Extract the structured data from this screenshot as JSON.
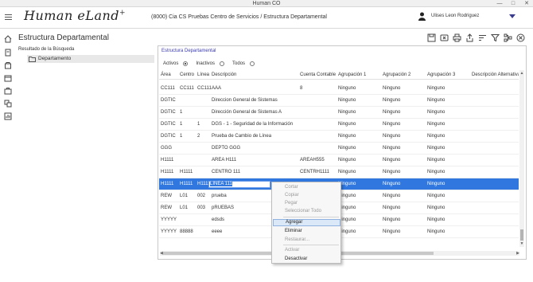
{
  "window": {
    "title": "Human CO",
    "controls": [
      "—",
      "□",
      "✕"
    ]
  },
  "header": {
    "logo": "Human eLand",
    "logo_mark": "+",
    "breadcrumb": "(8000) Cia  CS  Pruebas Centro de Servicios / Estructura Departamental",
    "user_name": "Ulises Leon Rodriguez"
  },
  "page": {
    "title": "Estructura Departamental"
  },
  "toolbar": {
    "icons": [
      "save-icon",
      "cancel-icon",
      "print-icon",
      "export-icon",
      "sort-icon",
      "filter-icon",
      "hierarchy-icon",
      "close-icon"
    ]
  },
  "tree": {
    "heading": "Resultado de la Búsqueda",
    "node_label": "Departamento"
  },
  "panel": {
    "title": "Estructura Departamental",
    "filters": {
      "active": "Activos",
      "inactive": "Inactivos",
      "all": "Todos",
      "selected": "active"
    }
  },
  "grid": {
    "columns": [
      "Área",
      "Centro",
      "Línea",
      "Descripción",
      "Cuenta Contable",
      "Agrupación  1",
      "Agrupación  2",
      "Agrupación  3",
      "Descripción Alternativa"
    ],
    "rows": [
      [
        "CC111",
        "CC111",
        "CC111",
        "AAA",
        "8",
        "Ninguno",
        "Ninguno",
        "Ninguno"
      ],
      [
        "DGTIC",
        "",
        "",
        "Direccion General de Sistemas",
        "",
        "Ninguno",
        "Ninguno",
        "Ninguno"
      ],
      [
        "DGTIC",
        "1",
        "",
        "Dirección General de Sistemas A",
        "",
        "Ninguno",
        "Ninguno",
        "Ninguno"
      ],
      [
        "DGTIC",
        "1",
        "1",
        "DGS - 1 - Seguridad de la Información",
        "",
        "Ninguno",
        "Ninguno",
        "Ninguno"
      ],
      [
        "DGTIC",
        "1",
        "2",
        "Prueba de Cambio de Línea",
        "",
        "Ninguno",
        "Ninguno",
        "Ninguno"
      ],
      [
        "GGG",
        "",
        "",
        "DEPTO GGG",
        "",
        "Ninguno",
        "Ninguno",
        "Ninguno"
      ],
      [
        "H1111",
        "",
        "",
        "AREA H111",
        "AREAH555",
        "Ninguno",
        "Ninguno",
        "Ninguno"
      ],
      [
        "H1111",
        "H1111",
        "",
        "CENTRO 111",
        "CENTRH1111",
        "Ninguno",
        "Ninguno",
        "Ninguno"
      ],
      [
        "H1111",
        "H1111",
        "H1111",
        "LINEA 111",
        "",
        "Ninguno",
        "Ninguno",
        "Ninguno"
      ],
      [
        "REW",
        "L01",
        "002",
        "prueba",
        "",
        "Ninguno",
        "Ninguno",
        "Ninguno"
      ],
      [
        "REW",
        "L01",
        "003",
        "pRUEBAS",
        "",
        "Ninguno",
        "Ninguno",
        "Ninguno"
      ],
      [
        "YYYYY",
        "",
        "",
        "edsds",
        "",
        "Ninguno",
        "Ninguno",
        "Ninguno"
      ],
      [
        "YYYYY",
        "88888",
        "",
        "eeee",
        "",
        "Ninguno",
        "Ninguno",
        "Ninguno"
      ]
    ],
    "selected_row": 8,
    "edit_value": "LINEA 111"
  },
  "context_menu": {
    "items": [
      {
        "label": "Cortar",
        "enabled": false
      },
      {
        "label": "Copiar",
        "enabled": false
      },
      {
        "label": "Pegar",
        "enabled": false
      },
      {
        "label": "Seleccionar Todo",
        "enabled": false
      },
      {
        "label": "Agregar",
        "enabled": true,
        "highlighted": true
      },
      {
        "label": "Eliminar",
        "enabled": true
      },
      {
        "label": "Restaurar...",
        "enabled": false
      },
      {
        "label": "Activar",
        "enabled": false
      },
      {
        "label": "Desactivar",
        "enabled": true
      }
    ]
  },
  "colors": {
    "accent": "#3078e0",
    "panel_title": "#3b3bb5",
    "menu_highlight": "#dbe8f7"
  }
}
